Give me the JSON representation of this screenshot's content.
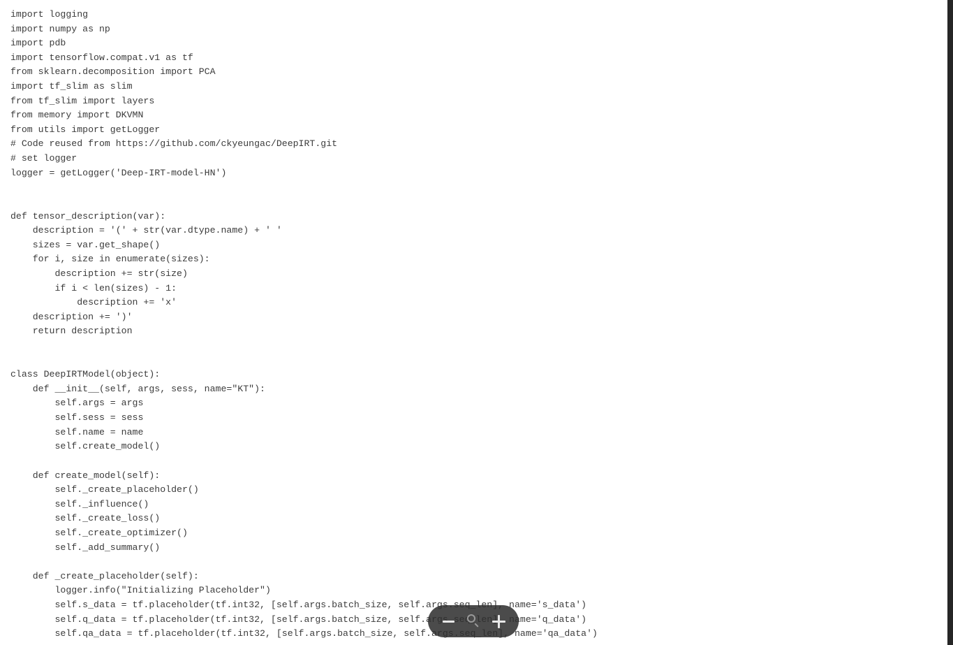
{
  "document": {
    "kind": "source-code-text",
    "language": "python",
    "text_color": "#3b3b3b",
    "background_color": "#ffffff",
    "lines": [
      "import logging",
      "import numpy as np",
      "import pdb",
      "import tensorflow.compat.v1 as tf",
      "from sklearn.decomposition import PCA",
      "import tf_slim as slim",
      "from tf_slim import layers",
      "from memory import DKVMN",
      "from utils import getLogger",
      "# Code reused from https://github.com/ckyeungac/DeepIRT.git",
      "# set logger",
      "logger = getLogger('Deep-IRT-model-HN')",
      "",
      "",
      "def tensor_description(var):",
      "    description = '(' + str(var.dtype.name) + ' '",
      "    sizes = var.get_shape()",
      "    for i, size in enumerate(sizes):",
      "        description += str(size)",
      "        if i < len(sizes) - 1:",
      "            description += 'x'",
      "    description += ')'",
      "    return description",
      "",
      "",
      "class DeepIRTModel(object):",
      "    def __init__(self, args, sess, name=\"KT\"):",
      "        self.args = args",
      "        self.sess = sess",
      "        self.name = name",
      "        self.create_model()",
      "",
      "    def create_model(self):",
      "        self._create_placeholder()",
      "        self._influence()",
      "        self._create_loss()",
      "        self._create_optimizer()",
      "        self._add_summary()",
      "",
      "    def _create_placeholder(self):",
      "        logger.info(\"Initializing Placeholder\")",
      "        self.s_data = tf.placeholder(tf.int32, [self.args.batch_size, self.args.seq_len], name='s_data')",
      "        self.q_data = tf.placeholder(tf.int32, [self.args.batch_size, self.args.seq_len], name='q_data')",
      "        self.qa_data = tf.placeholder(tf.int32, [self.args.batch_size, self.args.seq_len], name='qa_data')"
    ]
  },
  "zoom_control": {
    "zoom_out_label": "−",
    "zoom_reset_label": "search-icon",
    "zoom_in_label": "+",
    "background_color": "#2d2d2d",
    "icon_color": "#e8e8e8"
  }
}
